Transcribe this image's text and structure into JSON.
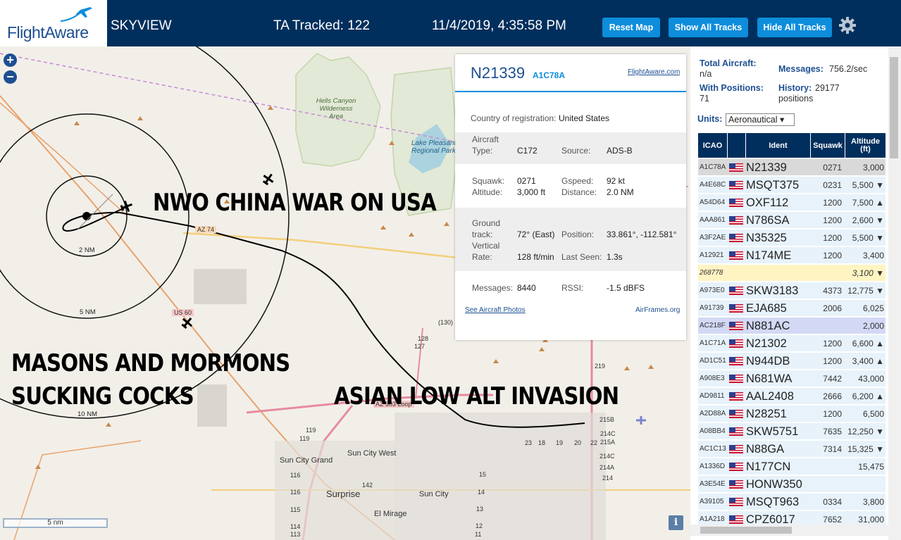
{
  "header": {
    "brand": "FlightAware",
    "app_name": "SKYVIEW",
    "tracked": "TA Tracked: 122",
    "datetime": "11/4/2019, 4:35:58 PM",
    "buttons": {
      "reset": "Reset Map",
      "show_all": "Show All Tracks",
      "hide_all": "Hide All Tracks"
    },
    "settings_icon": "gear-icon"
  },
  "map": {
    "zoom_in": "+",
    "zoom_out": "−",
    "places": [
      "Hells Canyon Wilderness Area",
      "Lake Pleasant Regional Park",
      "Sun City Grand",
      "Sun City West",
      "Surprise",
      "Sun City",
      "El Mirage"
    ],
    "road_labels": [
      "AZ 74",
      "US 60",
      "AZ 303 Loop"
    ],
    "route_numbers": [
      "(130)",
      "128",
      "127",
      "219",
      "215B",
      "214C",
      "215A",
      "214C",
      "214A",
      "214",
      "119",
      "119",
      "116",
      "116",
      "115",
      "114",
      "113",
      "142",
      "15",
      "14",
      "13",
      "12",
      "11",
      "18",
      "19",
      "20",
      "22",
      "23"
    ],
    "range_rings": [
      "2 NM",
      "5 NM",
      "10 NM"
    ],
    "overlay_texts": [
      "NWO CHINA WAR ON USA",
      "MASONS AND MORMONS",
      "SUCKING COCKS",
      "ASIAN LOW ALT INVASION"
    ],
    "scale": "5 nm",
    "info_button": "i"
  },
  "popup": {
    "registration": "N21339",
    "icao": "A1C78A",
    "fa_link": "FlightAware.com",
    "country_label": "Country of registration:",
    "country_value": "United States",
    "aircraft_type_label1": "Aircraft",
    "aircraft_type_label2": "Type:",
    "aircraft_type": "C172",
    "source_label": "Source:",
    "source": "ADS-B",
    "squawk_label": "Squawk:",
    "squawk": "0271",
    "gspeed_label": "Gspeed:",
    "gspeed": "92 kt",
    "altitude_label": "Altitude:",
    "altitude": "3,000 ft",
    "distance_label": "Distance:",
    "distance": "2.0 NM",
    "ground_label1": "Ground",
    "ground_label2": "track:",
    "track": "72° (East)",
    "position_label": "Position:",
    "position": "33.861°, -112.581°",
    "vertical_label1": "Vertical",
    "vertical_label2": "Rate:",
    "vrate": "128 ft/min",
    "lastseen_label": "Last Seen:",
    "lastseen": "1.3s",
    "messages_label": "Messages:",
    "messages": "8440",
    "rssi_label": "RSSI:",
    "rssi": "-1.5 dBFS",
    "photos_link": "See Aircraft Photos",
    "airframes_link": "AirFrames.org"
  },
  "sidebar": {
    "total_label": "Total Aircraft:",
    "total_value": "n/a",
    "messages_label": "Messages:",
    "messages_value": "756.2/sec",
    "positions_label": "With Positions:",
    "positions_value": "71",
    "history_label": "History:",
    "history_value": "29177",
    "history_unit": "positions",
    "units_label": "Units:",
    "units_value": "Aeronautical ▾",
    "table": {
      "headers": {
        "icao": "ICAO",
        "ident": "Ident",
        "squawk": "Squawk",
        "alt1": "Altitude",
        "alt2": "(ft)"
      },
      "rows": [
        {
          "icao": "A1C78A",
          "flag": true,
          "ident": "N21339",
          "squawk": "0271",
          "alt": "3,000",
          "style": "sel"
        },
        {
          "icao": "A4E68C",
          "flag": true,
          "ident": "MSQT375",
          "squawk": "0231",
          "alt": "5,500 ▼",
          "style": ""
        },
        {
          "icao": "A54D64",
          "flag": true,
          "ident": "OXF112",
          "squawk": "1200",
          "alt": "7,500 ▲",
          "style": ""
        },
        {
          "icao": "AAA861",
          "flag": true,
          "ident": "N786SA",
          "squawk": "1200",
          "alt": "2,600 ▼",
          "style": ""
        },
        {
          "icao": "A3F2AE",
          "flag": true,
          "ident": "N35325",
          "squawk": "1200",
          "alt": "5,500 ▼",
          "style": ""
        },
        {
          "icao": "A12921",
          "flag": true,
          "ident": "N174ME",
          "squawk": "1200",
          "alt": "3,400",
          "style": ""
        },
        {
          "icao": "268778",
          "flag": false,
          "ident": "",
          "squawk": "",
          "alt": "3,100 ▼",
          "style": "yellow"
        },
        {
          "icao": "A973E0",
          "flag": true,
          "ident": "SKW3183",
          "squawk": "4373",
          "alt": "12,775 ▼",
          "style": ""
        },
        {
          "icao": "A91739",
          "flag": true,
          "ident": "EJA685",
          "squawk": "2006",
          "alt": "6,025",
          "style": ""
        },
        {
          "icao": "AC218F",
          "flag": true,
          "ident": "N881AC",
          "squawk": "",
          "alt": "2,000",
          "style": "purple"
        },
        {
          "icao": "A1C71A",
          "flag": true,
          "ident": "N21302",
          "squawk": "1200",
          "alt": "6,600 ▲",
          "style": ""
        },
        {
          "icao": "AD1C51",
          "flag": true,
          "ident": "N944DB",
          "squawk": "1200",
          "alt": "3,400 ▲",
          "style": ""
        },
        {
          "icao": "A908E3",
          "flag": true,
          "ident": "N681WA",
          "squawk": "7442",
          "alt": "43,000",
          "style": ""
        },
        {
          "icao": "AD9811",
          "flag": true,
          "ident": "AAL2408",
          "squawk": "2666",
          "alt": "6,200 ▲",
          "style": ""
        },
        {
          "icao": "A2D88A",
          "flag": true,
          "ident": "N28251",
          "squawk": "1200",
          "alt": "6,500",
          "style": ""
        },
        {
          "icao": "A08BB4",
          "flag": true,
          "ident": "SKW5751",
          "squawk": "7635",
          "alt": "12,250 ▼",
          "style": ""
        },
        {
          "icao": "AC1C13",
          "flag": true,
          "ident": "N88GA",
          "squawk": "7314",
          "alt": "15,325 ▼",
          "style": ""
        },
        {
          "icao": "A1336D",
          "flag": true,
          "ident": "N177CN",
          "squawk": "",
          "alt": "15,475",
          "style": ""
        },
        {
          "icao": "A3E54E",
          "flag": true,
          "ident": "HONW350",
          "squawk": "",
          "alt": "",
          "style": ""
        },
        {
          "icao": "A39105",
          "flag": true,
          "ident": "MSQT963",
          "squawk": "0334",
          "alt": "3,800",
          "style": ""
        },
        {
          "icao": "A1A218",
          "flag": true,
          "ident": "CPZ6017",
          "squawk": "7652",
          "alt": "31,000",
          "style": ""
        }
      ]
    }
  },
  "colors": {
    "header_bg": "#002f5d",
    "button_bg": "#0d8ddb",
    "map_bg": "#f2efe9",
    "brand_blue": "#1d4f91"
  }
}
